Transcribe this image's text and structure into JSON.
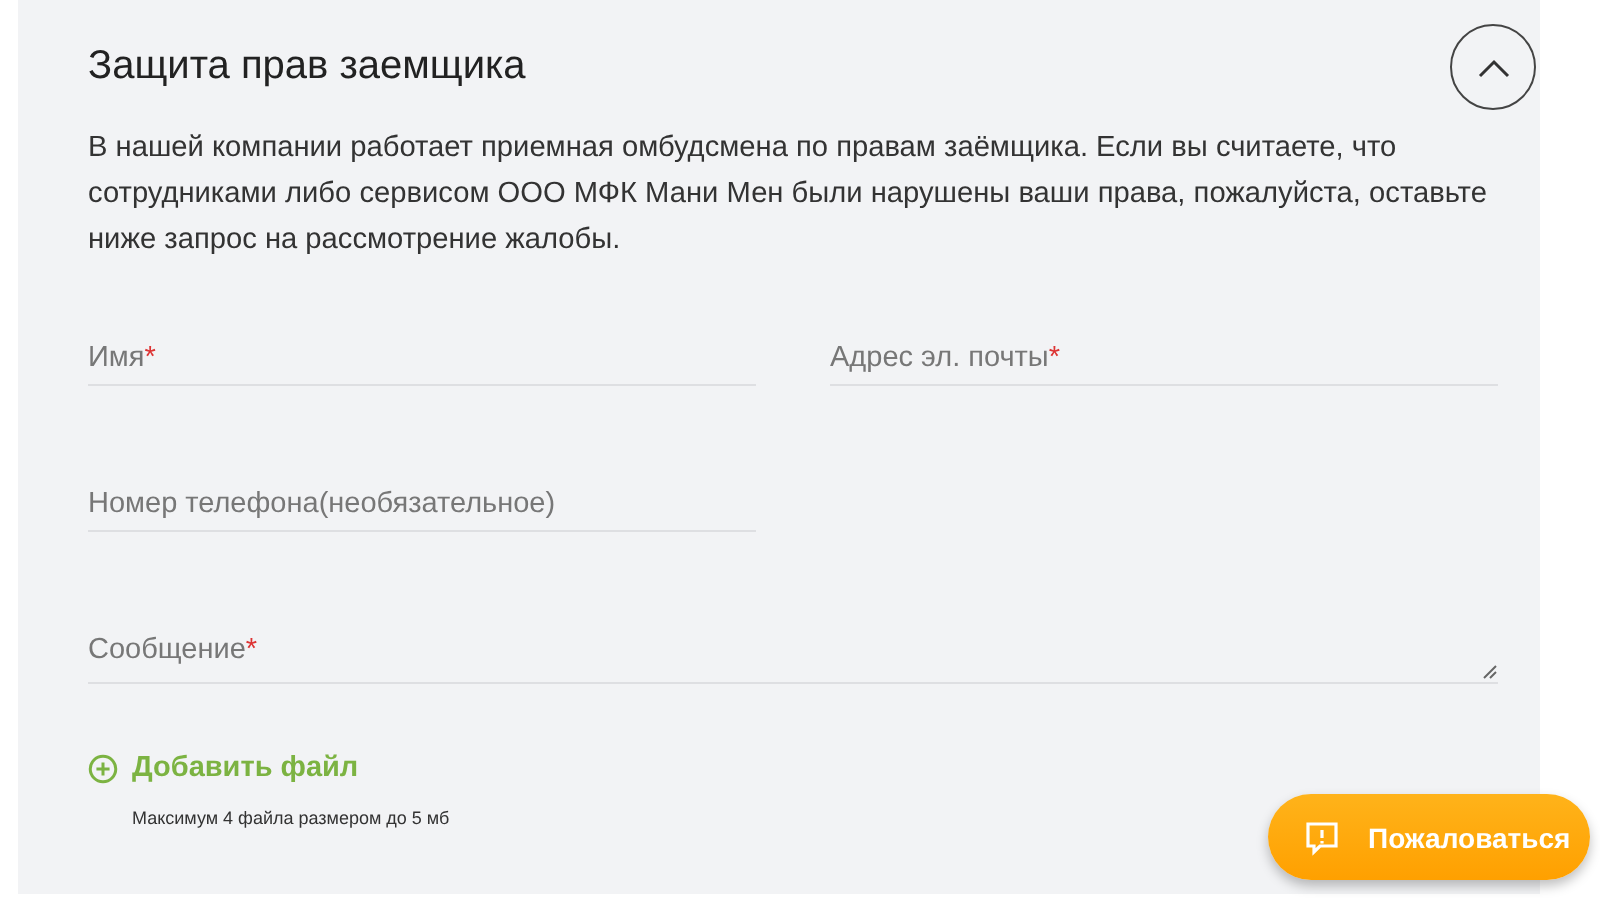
{
  "section": {
    "title": "Защита прав заемщика",
    "expanded": true,
    "description": "В нашей компании работает приемная омбудсмена по правам заёмщика. Если вы считаете, что сотрудниками либо сервисом ООО МФК Мани Мен были нарушены ваши права, пожалуйста, оставьте ниже запрос на рассмотрение жалобы."
  },
  "form": {
    "fields": [
      {
        "kind": "input",
        "placeholder": "Имя",
        "required_mark": "*"
      },
      {
        "kind": "input",
        "placeholder": "Адрес эл. почты",
        "required_mark": "*"
      },
      {
        "kind": "input",
        "placeholder": "Номер телефона(необязательное)"
      },
      {
        "kind": "textarea",
        "placeholder": "Сообщение",
        "required_mark": "*"
      }
    ],
    "add_file": "Добавить файл",
    "file_note": "Максимум 4 файла размером до 5 мб"
  },
  "complain_button": "Пожаловаться"
}
